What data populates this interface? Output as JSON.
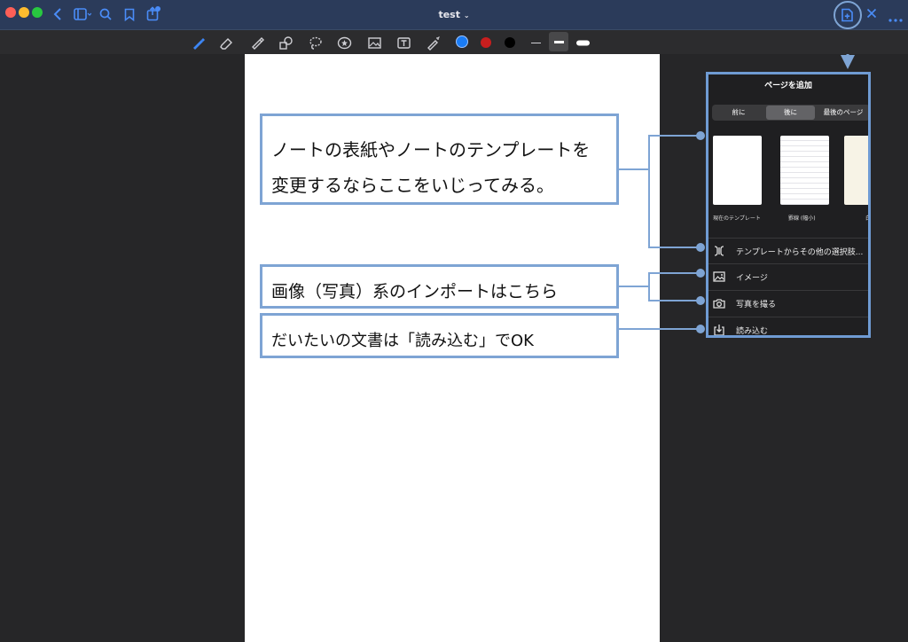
{
  "window": {
    "title": "test",
    "title_chevron": "⌄"
  },
  "toolbar": {
    "colors": [
      "#1a7cf5",
      "#c81e1e",
      "#000000"
    ]
  },
  "panel": {
    "title": "ページを追加",
    "segments": [
      "前に",
      "後に",
      "最後のページ"
    ],
    "templates": [
      "現在のテンプレート",
      "罫線 (幅小)",
      "白"
    ],
    "rows": [
      "テンプレートからその他の選択肢...",
      "イメージ",
      "写真を撮る",
      "読み込む"
    ]
  },
  "callouts": {
    "template_line1": "ノートの表紙やノートのテンプレートを",
    "template_line2": "変更するならここをいじってみる。",
    "image": "画像（写真）系のインポートはこちら",
    "document": "だいたいの文書は「読み込む」でOK"
  }
}
